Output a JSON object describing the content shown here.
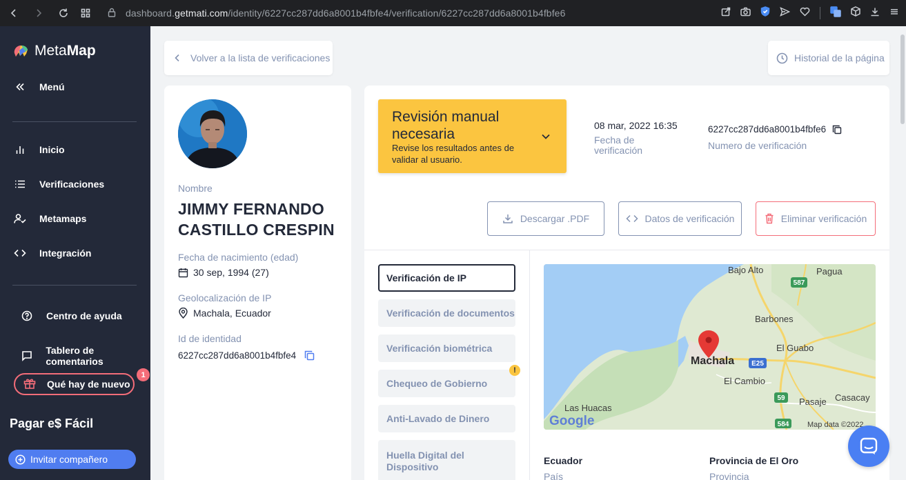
{
  "browser": {
    "url_prefix": "dashboard.",
    "url_host": "getmati.com",
    "url_path": "/identity/6227cc287dd6a8001b4fbfe4/verification/6227cc287dd6a8001b4fbfe6"
  },
  "sidebar": {
    "logo_part1": "Meta",
    "logo_part2": "Map",
    "menu_label": "Menú",
    "items": [
      {
        "label": "Inicio",
        "icon": "bar-chart-icon"
      },
      {
        "label": "Verificaciones",
        "icon": "list-icon"
      },
      {
        "label": "Metamaps",
        "icon": "user-check-icon"
      },
      {
        "label": "Integración",
        "icon": "code-icon"
      }
    ],
    "help_label": "Centro de ayuda",
    "feedback_label": "Tablero de comentarios",
    "whats_new_label": "Qué hay de nuevo",
    "whats_new_badge": "1",
    "company_name": "Pagar e$ Fácil",
    "invite_label": "Invitar compañero"
  },
  "header": {
    "back_label": "Volver a la lista de verificaciones",
    "history_label": "Historial de la página"
  },
  "profile": {
    "name_label": "Nombre",
    "name": "JIMMY FERNANDO CASTILLO CRESPIN",
    "dob_label": "Fecha de nacimiento (edad)",
    "dob": "30 sep, 1994 (27)",
    "geo_label": "Geolocalización de IP",
    "geo": "Machala, Ecuador",
    "id_label": "Id de identidad",
    "id": "6227cc287dd6a8001b4fbfe4"
  },
  "verification": {
    "status_title": "Revisión manual necesaria",
    "status_sub": "Revise los resultados antes de validar al usuario.",
    "date": "08 mar, 2022 16:35",
    "date_label": "Fecha de verificación",
    "number": "6227cc287dd6a8001b4fbfe6",
    "number_label": "Numero de verificación",
    "status_color": "#fbc540"
  },
  "actions": {
    "download": "Descargar .PDF",
    "data": "Datos de verificación",
    "delete": "Eliminar verificación"
  },
  "tabs": [
    {
      "label": "Verificación de IP",
      "active": true
    },
    {
      "label": "Verificación de documentos",
      "active": false
    },
    {
      "label": "Verificación biométrica",
      "active": false
    },
    {
      "label": "Chequeo de Gobierno",
      "active": false,
      "warning": "!"
    },
    {
      "label": "Anti-Lavado de Dinero",
      "active": false
    },
    {
      "label": "Huella Digital del Dispositivo",
      "active": false
    }
  ],
  "map": {
    "places": {
      "bajo_alto": "Bajo Alto",
      "pagua": "Pagua",
      "barbones": "Barbones",
      "el_guabo": "El Guabo",
      "machala": "Machala",
      "el_cambio": "El Cambio",
      "las_huacas": "Las Huacas",
      "pasaje": "Pasaje",
      "casacay": "Casacay"
    },
    "shields": {
      "r587": "587",
      "e25": "E25",
      "r59": "59",
      "r584": "584"
    },
    "google": "Google",
    "attribution": "Map data ©2022"
  },
  "location": {
    "country": "Ecuador",
    "country_label": "País",
    "province": "Provincia de El Oro",
    "province_label": "Provincia"
  },
  "colors": {
    "sidebar_bg": "#232939",
    "accent": "#507df0",
    "warning": "#fbc540",
    "danger": "#f46d79"
  }
}
